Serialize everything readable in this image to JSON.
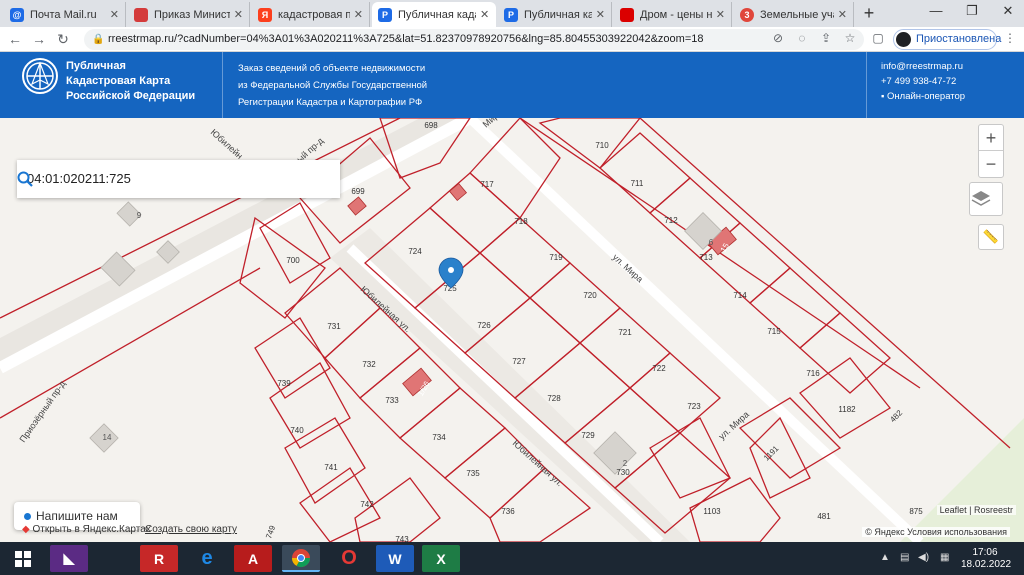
{
  "browser": {
    "tabs": [
      {
        "label": "Почта Mail.ru",
        "icon": "mail-icon",
        "color": "#1e6be6"
      },
      {
        "label": "Приказ Министер",
        "icon": "flag-icon",
        "color": "#d43b3b"
      },
      {
        "label": "кадастровая публ",
        "icon": "yandex-icon",
        "color": "#fc3f1d"
      },
      {
        "label": "Публичная кадас",
        "icon": "map-pin-icon",
        "color": "#1e6be6"
      },
      {
        "label": "Публичная кадас",
        "icon": "map-pin-icon",
        "color": "#1e6be6"
      },
      {
        "label": "Дром - цены на ",
        "icon": "drom-icon",
        "color": "#db0000"
      },
      {
        "label": "Земельные участ",
        "icon": "three-icon",
        "color": "#e0463b"
      }
    ],
    "url": "rreestrmap.ru/?cadNumber=04%3A01%3A020211%3A725&lat=51.82370978920756&lng=85.80455303922042&zoom=18",
    "profile_label": "Приостановлена"
  },
  "site": {
    "title": "Публичная Кадастровая Карта Российской Федерации",
    "title_lines": [
      "Публичная",
      "Кадастровая Карта",
      "Российской Федерации"
    ],
    "order_lines": [
      "Заказ сведений об объекте недвижимости",
      "из Федеральной Службы Государственной",
      "Регистрации Кадастра и Картографии РФ"
    ],
    "email": "info@rreestrmap.ru",
    "phone": "+7 499 938-47-72",
    "online": "Онлайн-оператор",
    "brand_color": "#1565c0"
  },
  "map": {
    "search_value": "04:01:020211:725",
    "chat_label": "Напишите нам",
    "yandex_open": "Открыть в Яндекс.Картах",
    "create_map": "Создать свою карту",
    "attribution": "Leaflet | Rosreestr",
    "yandex_terms": "© Яндекс  Условия использования",
    "streets": [
      "Юбилейная ул.",
      "Юбилейная ул.",
      "ул. Мира",
      "ул. Мира",
      "Приозёрный пр-д",
      "Юбилейный пр-д",
      "Мира"
    ],
    "parcels": [
      "698",
      "699",
      "700",
      "710",
      "711",
      "712",
      "713",
      "714",
      "715",
      "716",
      "717",
      "718",
      "719",
      "720",
      "721",
      "722",
      "723",
      "724",
      "725",
      "726",
      "727",
      "728",
      "729",
      "730",
      "731",
      "732",
      "733",
      "734",
      "735",
      "736",
      "739",
      "740",
      "741",
      "742",
      "743",
      "749",
      "1103",
      "1182",
      "1191",
      "481",
      "482",
      "875"
    ],
    "buildings": [
      "9",
      "14",
      "2",
      "6",
      "1/26",
      "15"
    ]
  },
  "taskbar": {
    "time": "17:06",
    "date": "18.02.2022"
  }
}
